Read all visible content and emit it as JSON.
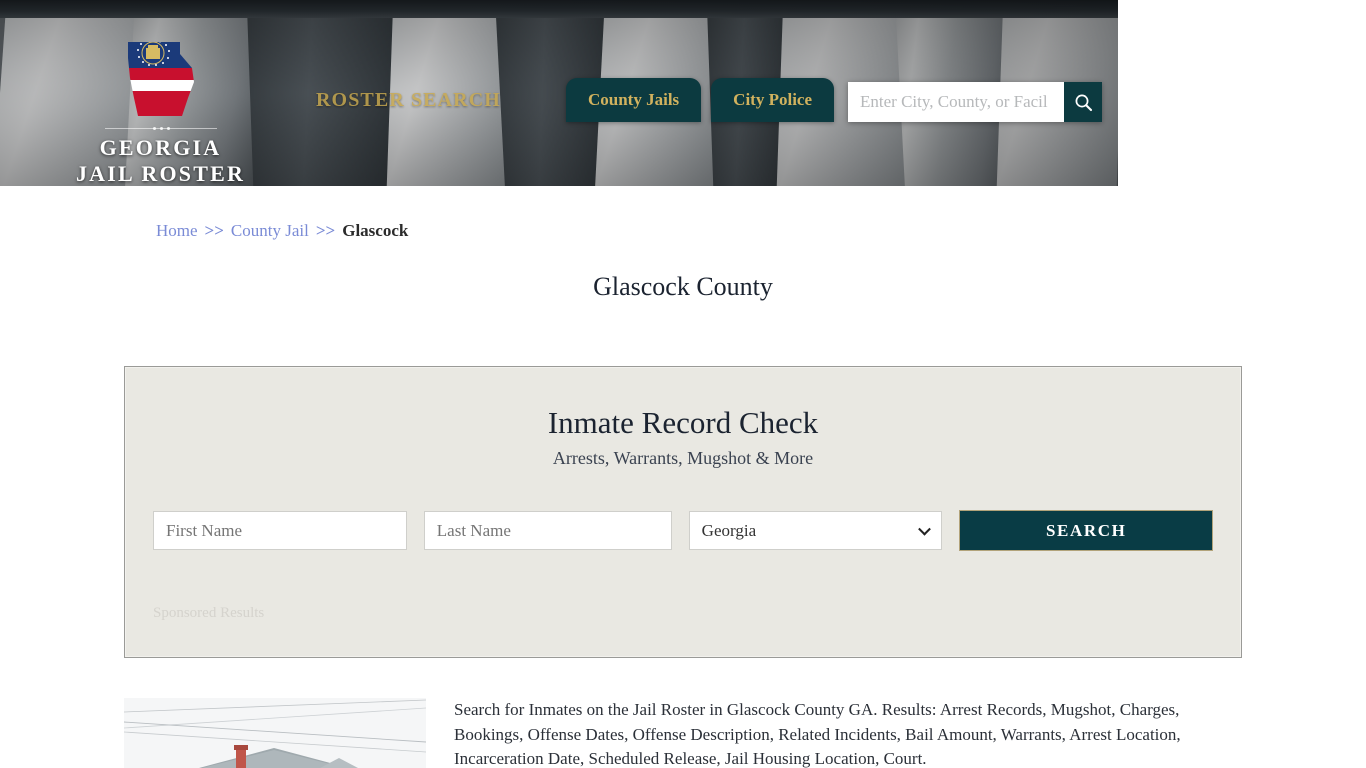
{
  "site": {
    "logo_line1": "GEORGIA",
    "logo_line2": "JAIL ROSTER",
    "logo_icon": "georgia-state-flag-shape",
    "tagline": "ROSTER SEARCH"
  },
  "header": {
    "nav": [
      {
        "label": "County Jails",
        "name": "nav-county-jails"
      },
      {
        "label": "City Police",
        "name": "nav-city-police"
      }
    ],
    "search": {
      "placeholder": "Enter City, County, or Facil",
      "value": "",
      "button_icon": "search-icon"
    }
  },
  "breadcrumb": {
    "home": "Home",
    "sep1": ">>",
    "county_jail": "County Jail",
    "sep2": ">>",
    "current": "Glascock"
  },
  "page": {
    "title": "Glascock County"
  },
  "card": {
    "title": "Inmate Record Check",
    "subtitle": "Arrests, Warrants, Mugshot & More",
    "first_name_placeholder": "First Name",
    "first_name_value": "",
    "last_name_placeholder": "Last Name",
    "last_name_value": "",
    "state_selected": "Georgia",
    "state_options": [
      "Georgia"
    ],
    "search_button": "SEARCH",
    "sponsored_label": "Sponsored Results"
  },
  "content": {
    "thumbnail_alt": "house-rooftop-photo",
    "description": "Search for Inmates on the Jail Roster in Glascock County GA. Results: Arrest Records, Mugshot, Charges, Bookings, Offense Dates, Offense Description, Related Incidents, Bail Amount, Warrants, Arrest Location, Incarceration Date, Scheduled Release, Jail Housing Location, Court."
  },
  "colors": {
    "teal": "#0c3a40",
    "gold": "#c9a94e",
    "card_bg": "#e9e8e2",
    "link": "#7a8bd6"
  }
}
